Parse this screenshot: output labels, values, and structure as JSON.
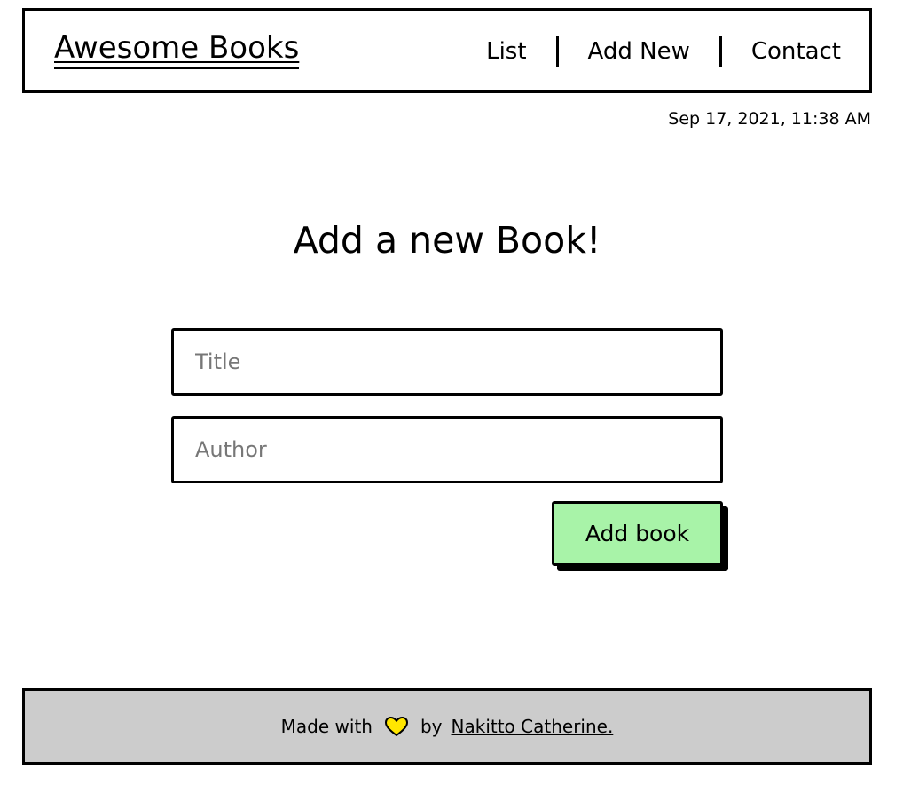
{
  "header": {
    "logo": "Awesome Books",
    "nav": [
      {
        "label": "List"
      },
      {
        "label": "Add New"
      },
      {
        "label": "Contact"
      }
    ]
  },
  "datetime": "Sep 17, 2021, 11:38 AM",
  "main": {
    "title": "Add a new Book!",
    "title_placeholder": "Title",
    "author_placeholder": "Author",
    "submit_label": "Add book"
  },
  "footer": {
    "made_with": "Made with",
    "by": "by",
    "author_link": "Nakitto Catherine."
  },
  "colors": {
    "button_bg": "#a8f3a8",
    "footer_bg": "#cccccc",
    "heart": "#ffe600"
  },
  "icons": {
    "heart": "heart-icon"
  }
}
